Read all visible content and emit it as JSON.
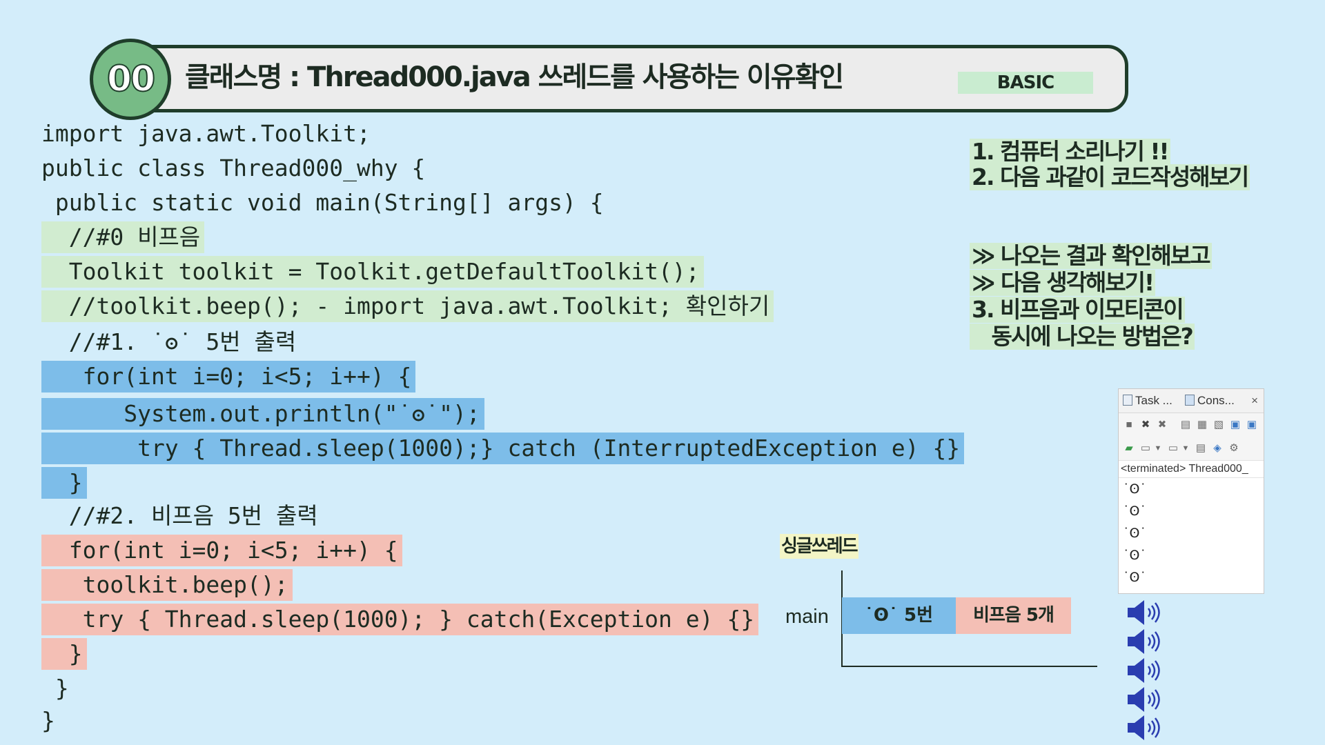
{
  "header": {
    "number": "00",
    "title": "클래스명 : Thread000.java   쓰레드를 사용하는 이유확인",
    "level": "BASIC"
  },
  "code": [
    {
      "text": "import java.awt.Toolkit;",
      "hl": ""
    },
    {
      "text": "public class Thread000_why {",
      "hl": ""
    },
    {
      "text": " public static void main(String[] args) {",
      "hl": ""
    },
    {
      "text": "  //#0 비프음",
      "hl": "green"
    },
    {
      "text": "  Toolkit toolkit = Toolkit.getDefaultToolkit();",
      "hl": "green"
    },
    {
      "text": "  //toolkit.beep(); - import java.awt.Toolkit; 확인하기",
      "hl": "green"
    },
    {
      "text": "  //#1. ˙ʘ˙ 5번 출력",
      "hl": ""
    },
    {
      "text": "   for(int i=0; i<5; i++) {",
      "hl": "blue"
    },
    {
      "text": "      System.out.println(\"˙ʘ˙\");",
      "hl": "blue"
    },
    {
      "text": "       try { Thread.sleep(1000);} catch (InterruptedException e) {}",
      "hl": "blue"
    },
    {
      "text": "  }",
      "hl": "blue"
    },
    {
      "text": "  //#2. 비프음 5번 출력",
      "hl": ""
    },
    {
      "text": "  for(int i=0; i<5; i++) {",
      "hl": "pink"
    },
    {
      "text": "   toolkit.beep();",
      "hl": "pink"
    },
    {
      "text": "   try { Thread.sleep(1000); } catch(Exception e) {}",
      "hl": "pink"
    },
    {
      "text": "  }",
      "hl": "pink"
    },
    {
      "text": " }",
      "hl": ""
    },
    {
      "text": "}",
      "hl": ""
    }
  ],
  "notes": [
    "1. 컴퓨터 소리나기 !!",
    "2. 다음 과같이 코드작성해보기",
    "≫ 나오는 결과 확인해보고",
    "≫ 다음 생각해보기!",
    "3. 비프음과 이모티콘이",
    "   동시에 나오는 방법은?"
  ],
  "diagram": {
    "title": "싱글쓰레드",
    "thread_label": "main",
    "segment_1": "˙ʘ˙ 5번",
    "segment_2": "비프음 5개"
  },
  "console": {
    "tab_task": "Task ...",
    "tab_console": "Cons...",
    "close": "×",
    "status": "<terminated> Thread000_",
    "output": [
      "˙ʘ˙",
      "˙ʘ˙",
      "˙ʘ˙",
      "˙ʘ˙",
      "˙ʘ˙"
    ]
  },
  "speakers": {
    "count": 5,
    "icon": "speaker-icon",
    "color": "#2a3db0"
  },
  "colors": {
    "background": "#d3edfa",
    "highlight_green": "#d1ecd0",
    "highlight_blue": "#7dbde9",
    "highlight_pink": "#f4bfb5"
  }
}
